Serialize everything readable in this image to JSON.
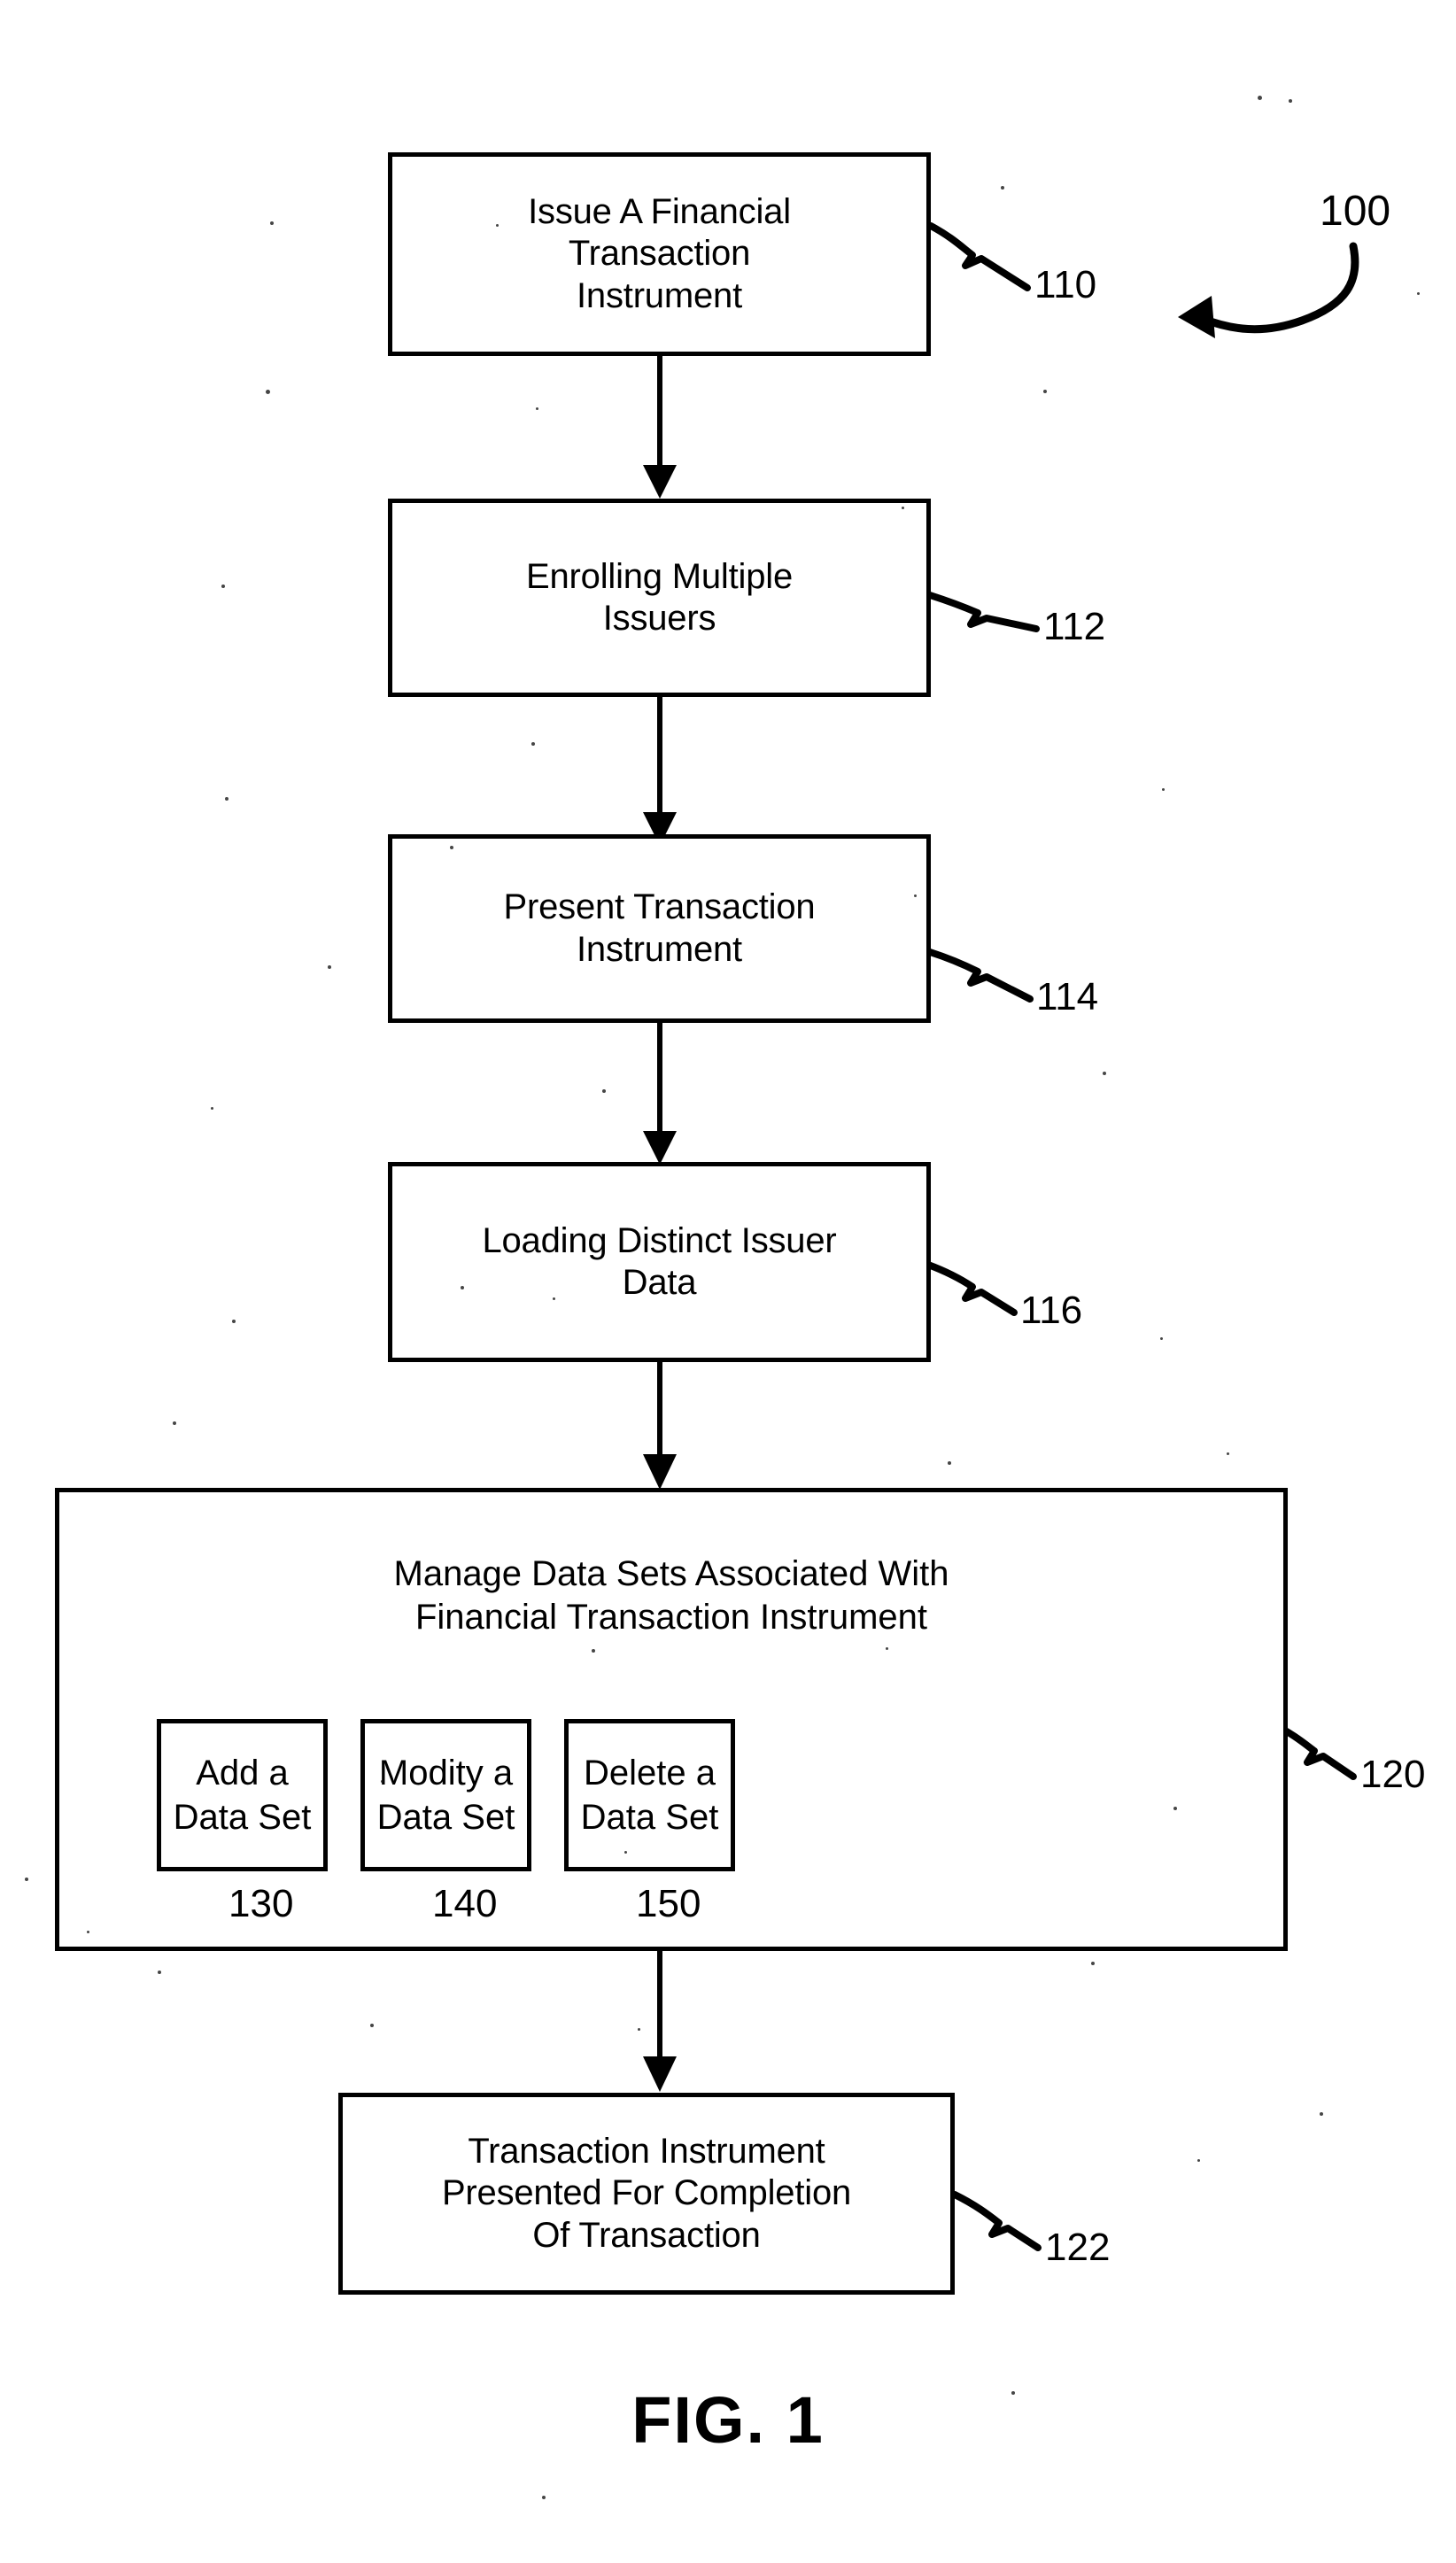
{
  "figure": {
    "caption": "FIG. 1",
    "system_ref": "100"
  },
  "nodes": [
    {
      "id": "issue-financial-transaction-instrument",
      "label": "Issue A Financial\nTransaction\nInstrument",
      "ref": "110"
    },
    {
      "id": "enrolling-multiple-issuers",
      "label": "Enrolling Multiple\nIssuers",
      "ref": "112"
    },
    {
      "id": "present-transaction-instrument",
      "label": "Present Transaction\nInstrument",
      "ref": "114"
    },
    {
      "id": "loading-distinct-issuer-data",
      "label": "Loading Distinct Issuer\nData",
      "ref": "116"
    },
    {
      "id": "transaction-instrument-presented",
      "label": "Transaction Instrument\nPresented For Completion\nOf Transaction",
      "ref": "122"
    }
  ],
  "manage_group": {
    "title": "Manage Data Sets Associated With\nFinancial Transaction Instrument",
    "ref": "120",
    "operations": [
      {
        "id": "add-a-data-set",
        "label": "Add a\nData Set",
        "ref": "130"
      },
      {
        "id": "modity-a-data-set",
        "label": "Modity a\nData Set",
        "ref": "140"
      },
      {
        "id": "delete-a-data-set",
        "label": "Delete a\nData Set",
        "ref": "150"
      }
    ]
  },
  "colors": {
    "ink": "#000000",
    "paper": "#ffffff"
  }
}
